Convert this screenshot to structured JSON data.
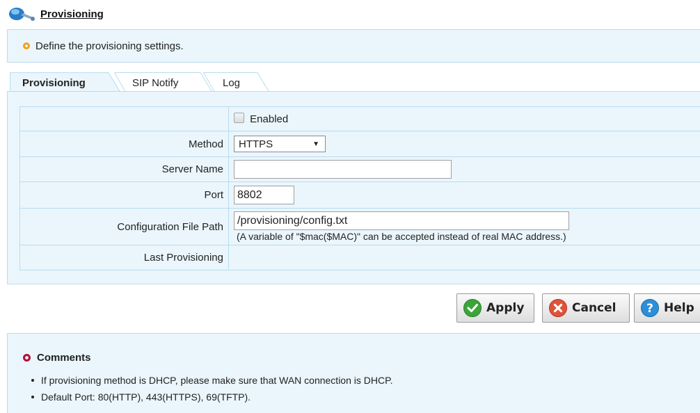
{
  "header": {
    "title": "Provisioning",
    "icon": "wrench-globe-icon"
  },
  "description": {
    "text": "Define the provisioning settings."
  },
  "tabs": [
    {
      "label": "Provisioning",
      "active": true
    },
    {
      "label": "SIP Notify",
      "active": false
    },
    {
      "label": "Log",
      "active": false
    }
  ],
  "form": {
    "enabled": {
      "label": "Enabled",
      "checked": false
    },
    "method": {
      "label": "Method",
      "value": "HTTPS"
    },
    "server_name": {
      "label": "Server Name",
      "value": ""
    },
    "port": {
      "label": "Port",
      "value": "8802"
    },
    "config_path": {
      "label": "Configuration File Path",
      "value": "/provisioning/config.txt",
      "note": "(A variable of \"$mac($MAC)\" can be accepted instead of real MAC address.)"
    },
    "last_provisioning": {
      "label": "Last Provisioning",
      "value": ""
    }
  },
  "buttons": {
    "apply": "Apply",
    "cancel": "Cancel",
    "help": "Help"
  },
  "comments": {
    "title": "Comments",
    "items": [
      "If provisioning method is DHCP, please make sure that WAN connection is DHCP.",
      "Default Port: 80(HTTP), 443(HTTPS), 69(TFTP)."
    ]
  },
  "colors": {
    "panel_bg": "#eaf6fc",
    "panel_border": "#b8dcef",
    "apply_green": "#3aa63a",
    "cancel_red": "#e0523a",
    "help_blue": "#2c8fd8"
  }
}
